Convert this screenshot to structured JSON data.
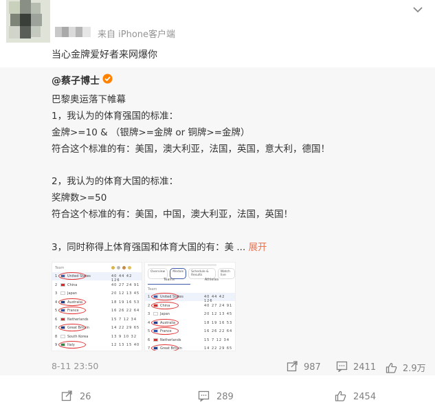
{
  "post": {
    "source": "来自 iPhone客户端",
    "text": "当心金牌爱好者来网爆你"
  },
  "repost": {
    "author": "@蔡子博士",
    "lines": [
      "巴黎奥运落下帷幕",
      "1，我认为的体育强国的标准：",
      "金牌>=10 &  （银牌>=金牌 or 铜牌>=金牌）",
      "符合这个标准的有：美国，澳大利亚，法国，英国，意大利，德国！",
      "2，我认为的体育大国的标准：",
      "奖牌数>=50",
      "符合这个标准的有：美国，中国，澳大利亚，法国，英国！",
      "3，同时称得上体育强国和体育大国的有：美 ..."
    ],
    "expand_label": "展开",
    "time": "8-11 23:50",
    "actions": {
      "reposts": "987",
      "comments": "2411",
      "likes": "2.9万"
    },
    "thumb1": {
      "header": "Team",
      "rows": [
        {
          "rank": "1",
          "country": "United States",
          "nums": "40 44 42 126",
          "flag": "#3c5aa8"
        },
        {
          "rank": "2",
          "country": "China",
          "nums": "40 27 24 91",
          "flag": "#d42a2a"
        },
        {
          "rank": "3",
          "country": "Japan",
          "nums": "20 12 13 45",
          "flag": "#ffffff"
        },
        {
          "rank": "4",
          "country": "Australia",
          "nums": "18 19 16 53",
          "flag": "#1f3a8a"
        },
        {
          "rank": "5",
          "country": "France",
          "nums": "16 26 22 64",
          "flag": "#2b4fa8"
        },
        {
          "rank": "6",
          "country": "Netherlands",
          "nums": "15 7 12 34",
          "flag": "#c8332f"
        },
        {
          "rank": "7",
          "country": "Great Britain",
          "nums": "14 22 29 65",
          "flag": "#1f3a8a"
        },
        {
          "rank": "8",
          "country": "South Korea",
          "nums": "13 9 10 32",
          "flag": "#ffffff"
        },
        {
          "rank": "9",
          "country": "Italy",
          "nums": "12 13 15 40",
          "flag": "#2e8b3e"
        }
      ]
    },
    "thumb2": {
      "tabs": [
        "Overview",
        "Medals",
        "Schedule & Results",
        "Watch live"
      ],
      "subtabs": [
        "Teams",
        "Athletes"
      ],
      "header": "Team",
      "rows": [
        {
          "rank": "1",
          "country": "United States",
          "nums": "40 44 42 126",
          "flag": "#3c5aa8"
        },
        {
          "rank": "2",
          "country": "China",
          "nums": "40 27 24 91",
          "flag": "#d42a2a"
        },
        {
          "rank": "3",
          "country": "Japan",
          "nums": "20 12 13 45",
          "flag": "#ffffff"
        },
        {
          "rank": "4",
          "country": "Australia",
          "nums": "18 19 16 53",
          "flag": "#1f3a8a"
        },
        {
          "rank": "5",
          "country": "France",
          "nums": "16 26 22 64",
          "flag": "#2b4fa8"
        },
        {
          "rank": "6",
          "country": "Netherlands",
          "nums": "15 7 12 34",
          "flag": "#c8332f"
        },
        {
          "rank": "7",
          "country": "Great Britain",
          "nums": "14 22 29 65",
          "flag": "#1f3a8a"
        }
      ]
    }
  },
  "bottom": {
    "reposts": "26",
    "comments": "289",
    "likes": "2454"
  },
  "colors": {
    "link": "#eb7350",
    "muted": "#939393",
    "repost_bg": "#f7f7f7",
    "badge": "#ff8200"
  },
  "icons": [
    "chevron-down-icon",
    "verified-icon",
    "repost-icon",
    "comment-icon",
    "like-icon"
  ]
}
